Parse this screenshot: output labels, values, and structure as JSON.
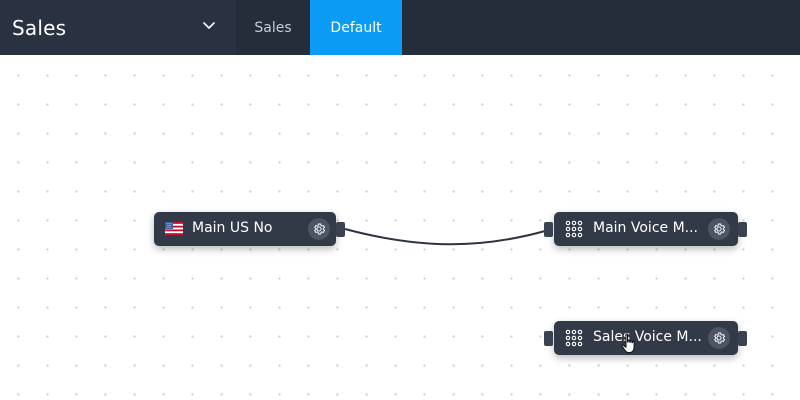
{
  "header": {
    "workspace_title": "Sales",
    "tabs": [
      {
        "label": "Sales",
        "active": false
      },
      {
        "label": "Default",
        "active": true
      }
    ]
  },
  "nodes": [
    {
      "label": "Main US No",
      "icon": "us-flag-icon"
    },
    {
      "label": "Main Voice M...",
      "icon": "dialpad-icon"
    },
    {
      "label": "Sales Voice M...",
      "icon": "dialpad-icon"
    }
  ],
  "colors": {
    "header_bg": "#262d3a",
    "active_tab": "#0b9bf5",
    "node_bg": "#323a48",
    "canvas_bg": "#ffffff"
  }
}
